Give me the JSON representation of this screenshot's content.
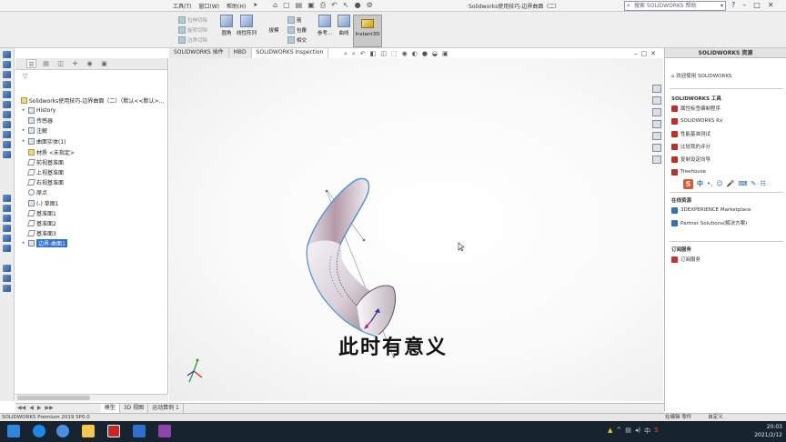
{
  "menu": {
    "items": [
      "工具(T)",
      "窗口(W)",
      "帮助(H)"
    ]
  },
  "window": {
    "title": "Solidworks使用技巧-边界曲面（二）"
  },
  "search": {
    "value": "搜索 SOLIDWORKS 帮助"
  },
  "ribbon": {
    "col1": [
      "拉伸切除",
      "旋转切除",
      "边界切除"
    ],
    "group2": {
      "label1": "圆角",
      "label2": "线性阵列",
      "label3": "拔模"
    },
    "group3": [
      "筋",
      "包覆",
      "相交"
    ],
    "col4": [
      "参考...",
      "曲线"
    ],
    "instant3d": "Instant3D"
  },
  "tabs": [
    "SOLIDWORKS 插件",
    "MBD",
    "SOLIDWORKS Inspection"
  ],
  "tree": {
    "root": "Solidworks使用技巧-边界曲面（二）（默认<<默认>...",
    "items": [
      {
        "label": "History",
        "kind": "folder",
        "expand": "▸"
      },
      {
        "label": "传感器",
        "kind": "folder",
        "expand": ""
      },
      {
        "label": "注解",
        "kind": "folder",
        "expand": "▸"
      },
      {
        "label": "曲面实体(1)",
        "kind": "folder",
        "expand": "▸"
      },
      {
        "label": "材质 <未指定>",
        "kind": "yellow",
        "expand": ""
      },
      {
        "label": "前视基准面",
        "kind": "plane",
        "expand": ""
      },
      {
        "label": "上视基准面",
        "kind": "plane",
        "expand": ""
      },
      {
        "label": "右视基准面",
        "kind": "plane",
        "expand": ""
      },
      {
        "label": "原点",
        "kind": "origin",
        "expand": ""
      },
      {
        "label": "(-) 草图1",
        "kind": "sketch",
        "expand": ""
      },
      {
        "label": "基准面1",
        "kind": "plane",
        "expand": ""
      },
      {
        "label": "基准面2",
        "kind": "plane",
        "expand": ""
      },
      {
        "label": "基准面3",
        "kind": "plane",
        "expand": ""
      },
      {
        "label": "边界-曲面1",
        "kind": "surface",
        "expand": "▸",
        "selected": true
      }
    ]
  },
  "taskpane": {
    "title": "SOLIDWORKS 资源",
    "welcome": "欢迎使用 SOLIDWORKS",
    "tools_title": "SOLIDWORKS 工具",
    "tools": [
      "属性标签编制程序",
      "SOLIDWORKS Rx",
      "性能基准测试",
      "比较我的评分",
      "复制设定向导",
      "Treehouse"
    ],
    "community_title": "在线资源",
    "community": [
      "3DEXPERIENCE Marketplace",
      "Partner Solutions(解决方案)"
    ],
    "subscription_title": "订阅服务",
    "subscription": [
      "订阅服务"
    ]
  },
  "subtitle": "此时有意义",
  "model_tabs": [
    "模型",
    "3D 视图",
    "运动算例 1"
  ],
  "status": {
    "left": "SOLIDWORKS Premium 2019 SP0.0",
    "mid": "在编辑 零件",
    "units": "自定义"
  },
  "clock": {
    "time": "20:03",
    "date": "2021/2/12"
  },
  "colors": {
    "accent": "#2f6fd0",
    "surface_edge": "#4a90d9",
    "taskbar": "#17242f"
  }
}
